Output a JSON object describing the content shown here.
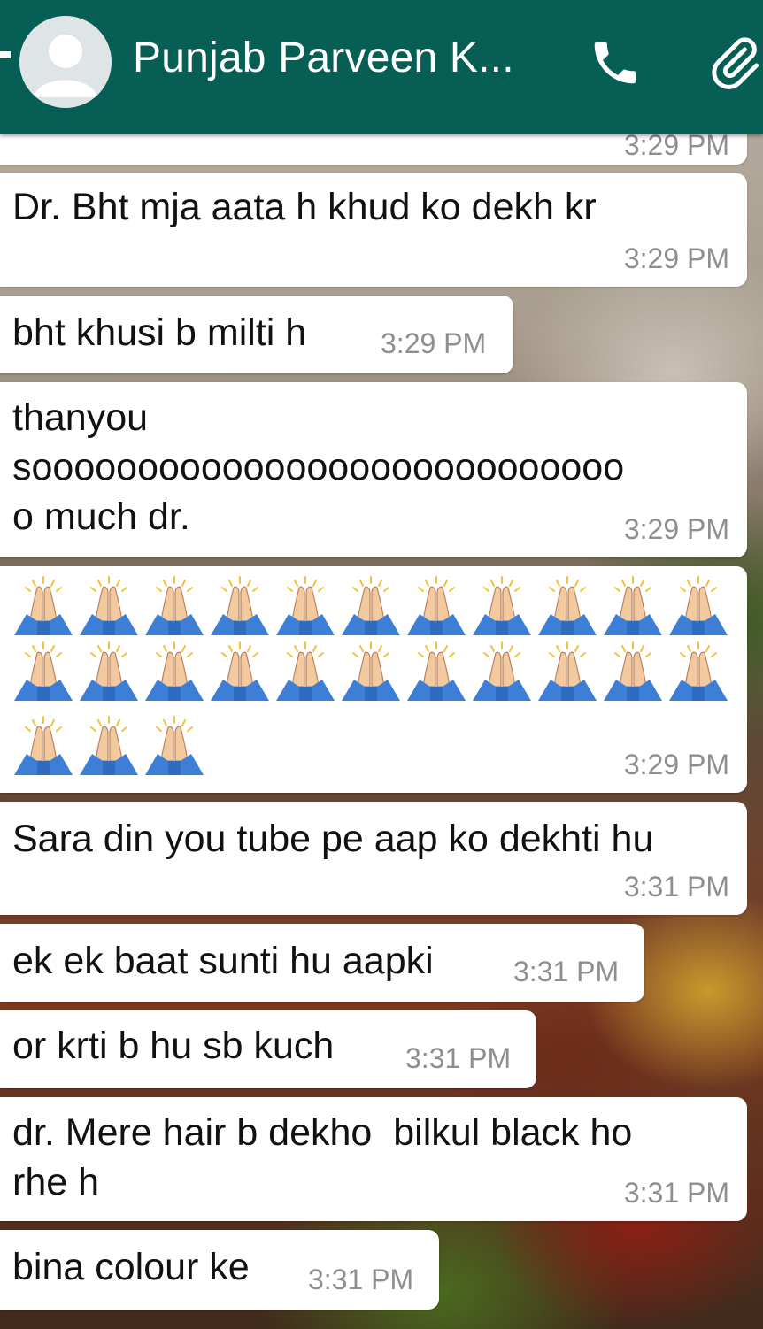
{
  "header": {
    "contact_name": "Punjab Parveen K...",
    "back_icon": "arrow-back-icon",
    "avatar_icon": "person-avatar-icon",
    "call_icon": "phone-icon",
    "attach_icon": "paperclip-icon",
    "color": "#075e54"
  },
  "messages": [
    {
      "text": "",
      "time": "3:29 PM"
    },
    {
      "text": "Dr. Bht mja aata h khud ko dekh kr",
      "time": "3:29 PM"
    },
    {
      "text": "bht khusi b milti h",
      "time": "3:29 PM"
    },
    {
      "text": "thanyou\nsoooooooooooooooooooooooooooo\no much dr.",
      "time": "3:29 PM"
    },
    {
      "emoji": "folded-hands",
      "emoji_count": 25,
      "time": "3:29 PM"
    },
    {
      "text": "Sara din you tube pe aap ko dekhti hu",
      "time": "3:31 PM"
    },
    {
      "text": "ek ek baat sunti hu aapki",
      "time": "3:31 PM"
    },
    {
      "text": "or krti b hu sb kuch",
      "time": "3:31 PM"
    },
    {
      "text": "dr. Mere hair b dekho  bilkul black ho\nrhe h",
      "time": "3:31 PM"
    },
    {
      "text": "bina colour ke",
      "time": "3:31 PM"
    }
  ]
}
